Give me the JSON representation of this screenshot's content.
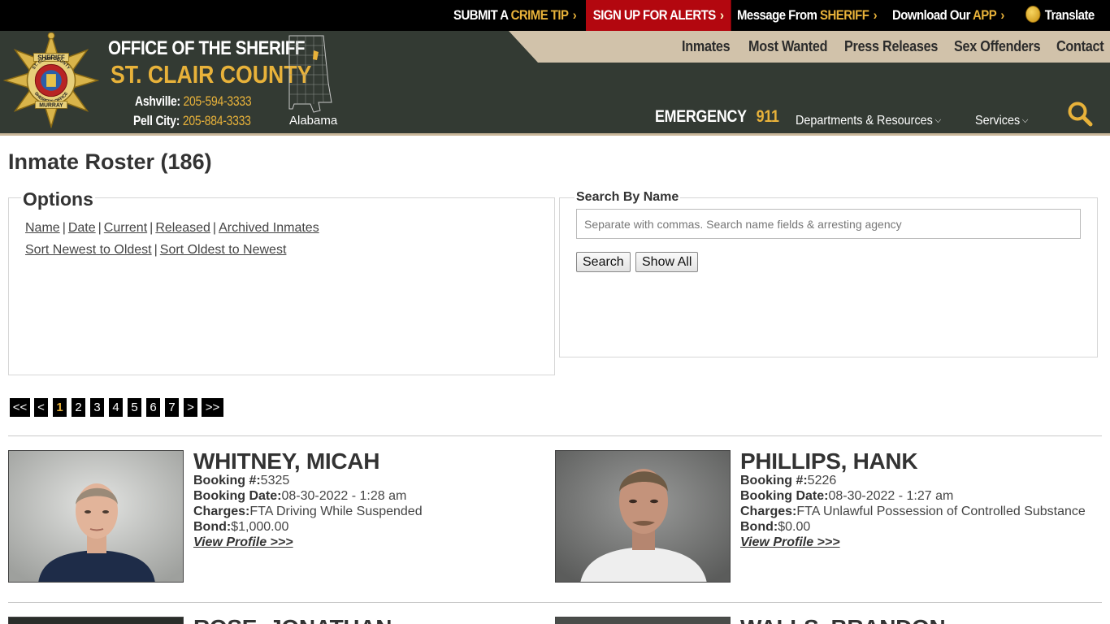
{
  "topbar": {
    "crime_tip_a": "SUBMIT A",
    "crime_tip_b": "CRIME TIP",
    "alerts": "SIGN UP FOR ALERTS",
    "message_a": "Message From",
    "message_b": "SHERIFF",
    "app_a": "Download Our",
    "app_b": "APP",
    "translate": "Translate"
  },
  "header": {
    "office": "OFFICE OF THE SHERIFF",
    "county": "ST. CLAIR COUNTY",
    "phone1_label": "Ashville:",
    "phone1": "205-594-3333",
    "phone2_label": "Pell City:",
    "phone2": "205-884-3333",
    "state": "Alabama",
    "emergency_label": "EMERGENCY",
    "emergency_num": "911",
    "badge_text_top": "SHERIFF",
    "badge_text_mid": "ST. CLAIR COUNTY",
    "badge_text_mid2": "SHERIFF'S OFFICE",
    "badge_text_bottom": "MURRAY"
  },
  "nav": {
    "main": [
      "Inmates",
      "Most Wanted",
      "Press Releases",
      "Sex Offenders",
      "Contact"
    ],
    "departments": "Departments & Resources",
    "services": "Services"
  },
  "page": {
    "title": "Inmate Roster (186)"
  },
  "options": {
    "legend": "Options",
    "filters": [
      "Name",
      "Date",
      "Current",
      "Released",
      "Archived Inmates"
    ],
    "sorts": [
      "Sort Newest to Oldest",
      "Sort Oldest to Newest"
    ],
    "sep": "|"
  },
  "search": {
    "legend": "Search By Name",
    "placeholder": "Separate with commas. Search name fields & arresting agency",
    "search_label": "Search",
    "show_all_label": "Show All"
  },
  "pagination": {
    "first": "<<",
    "prev": "<",
    "pages": [
      "1",
      "2",
      "3",
      "4",
      "5",
      "6",
      "7"
    ],
    "current": "1",
    "next": ">",
    "last": ">>"
  },
  "inmate_labels": {
    "booking_no": "Booking #:",
    "booking_date": "Booking Date:",
    "charges": "Charges:",
    "bond": "Bond:",
    "view_profile": "View Profile >>>"
  },
  "inmates": [
    {
      "name": "WHITNEY, MICAH",
      "booking_no": "5325",
      "booking_date": "08-30-2022 - 1:28 am",
      "charges": "FTA Driving While Suspended",
      "bond": "$1,000.00"
    },
    {
      "name": "PHILLIPS, HANK",
      "booking_no": "5226",
      "booking_date": "08-30-2022 - 1:27 am",
      "charges": "FTA Unlawful Possession of Controlled Substance",
      "bond": "$0.00"
    },
    {
      "name": "ROSE, JONATHAN"
    },
    {
      "name": "WALLS, BRANDON"
    }
  ],
  "colors": {
    "header_bg": "#333a33",
    "accent_gold": "#e8b23a",
    "alert_red": "#b3070f",
    "nav_strip": "#d1c2aa"
  }
}
